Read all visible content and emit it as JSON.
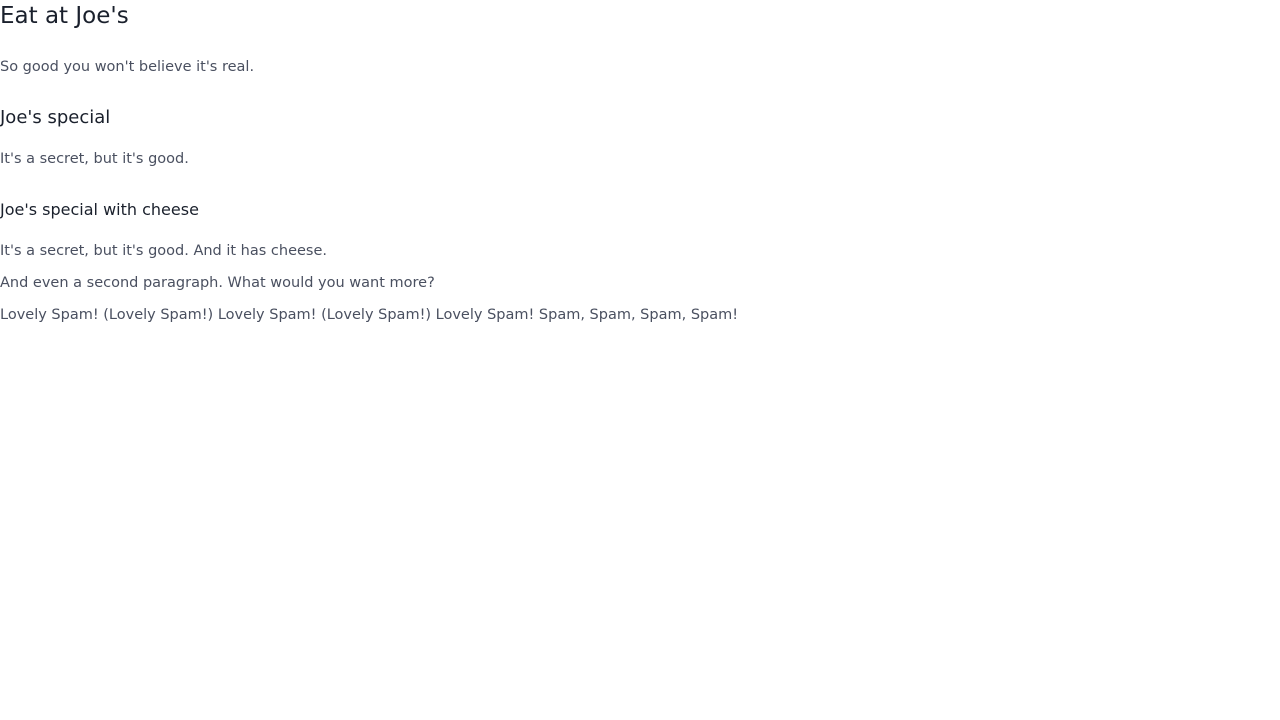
{
  "page": {
    "title": "Eat at Joe's",
    "tagline": "So good you won't believe it's real."
  },
  "sections": [
    {
      "heading": "Joe's special",
      "paragraphs": [
        "It's a secret, but it's good."
      ]
    },
    {
      "heading": "Joe's special with cheese",
      "paragraphs": [
        "It's a secret, but it's good. And it has cheese.",
        "And even a second paragraph. What would you want more?",
        "Lovely Spam! (Lovely Spam!) Lovely Spam! (Lovely Spam!) Lovely Spam! Spam, Spam, Spam, Spam!"
      ]
    }
  ]
}
